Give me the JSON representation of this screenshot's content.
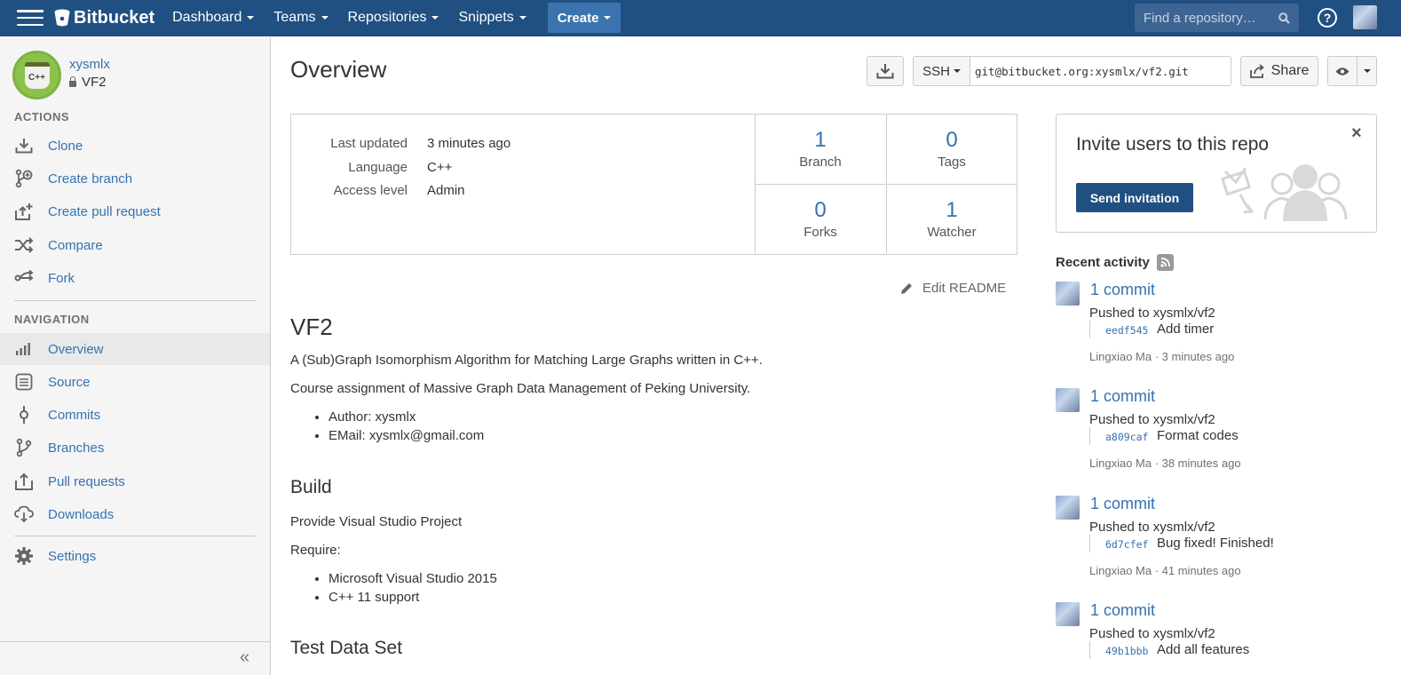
{
  "topbar": {
    "brand": "Bitbucket",
    "nav": [
      "Dashboard",
      "Teams",
      "Repositories",
      "Snippets"
    ],
    "create_label": "Create",
    "search_placeholder": "Find a repository…",
    "help": "?"
  },
  "sidebar": {
    "owner": "xysmlx",
    "repo": "VF2",
    "avatar_text": "C++",
    "actions_title": "ACTIONS",
    "actions": [
      {
        "label": "Clone",
        "icon": "download-icon"
      },
      {
        "label": "Create branch",
        "icon": "branch-plus-icon"
      },
      {
        "label": "Create pull request",
        "icon": "pull-request-plus-icon"
      },
      {
        "label": "Compare",
        "icon": "shuffle-icon"
      },
      {
        "label": "Fork",
        "icon": "fork-icon"
      }
    ],
    "navigation_title": "NAVIGATION",
    "navigation": [
      {
        "label": "Overview",
        "icon": "bar-chart-icon"
      },
      {
        "label": "Source",
        "icon": "document-icon"
      },
      {
        "label": "Commits",
        "icon": "commit-icon"
      },
      {
        "label": "Branches",
        "icon": "branch-icon"
      },
      {
        "label": "Pull requests",
        "icon": "pull-request-icon"
      },
      {
        "label": "Downloads",
        "icon": "cloud-download-icon"
      }
    ],
    "settings": {
      "label": "Settings",
      "icon": "gear-icon"
    },
    "collapse": "«"
  },
  "main": {
    "title": "Overview",
    "protocol": "SSH",
    "clone_url": "git@bitbucket.org:xysmlx/vf2.git",
    "share_label": "Share",
    "info": [
      {
        "key": "Last updated",
        "value": "3 minutes ago"
      },
      {
        "key": "Language",
        "value": "C++"
      },
      {
        "key": "Access level",
        "value": "Admin"
      }
    ],
    "stats": [
      {
        "num": "1",
        "label": "Branch"
      },
      {
        "num": "0",
        "label": "Tags"
      },
      {
        "num": "0",
        "label": "Forks"
      },
      {
        "num": "1",
        "label": "Watcher"
      }
    ],
    "edit_readme": "Edit README"
  },
  "readme": {
    "h1": "VF2",
    "p1": "A (Sub)Graph Isomorphism Algorithm for Matching Large Graphs written in C++.",
    "p2": "Course assignment of Massive Graph Data Management of Peking University.",
    "list1": [
      "Author: xysmlx",
      "EMail: xysmlx@gmail.com"
    ],
    "h2_build": "Build",
    "p3": "Provide Visual Studio Project",
    "p4": "Require:",
    "list2": [
      "Microsoft Visual Studio 2015",
      "C++ 11 support"
    ],
    "h2_test": "Test Data Set"
  },
  "invite": {
    "title": "Invite users to this repo",
    "button": "Send invitation",
    "close": "×"
  },
  "recent": {
    "title": "Recent activity",
    "items": [
      {
        "commits": "1 commit",
        "pushed": "Pushed to xysmlx/vf2",
        "hash": "eedf545",
        "message": "Add timer",
        "meta": "Lingxiao Ma · 3 minutes ago"
      },
      {
        "commits": "1 commit",
        "pushed": "Pushed to xysmlx/vf2",
        "hash": "a809caf",
        "message": "Format codes",
        "meta": "Lingxiao Ma · 38 minutes ago"
      },
      {
        "commits": "1 commit",
        "pushed": "Pushed to xysmlx/vf2",
        "hash": "6d7cfef",
        "message": "Bug fixed! Finished!",
        "meta": "Lingxiao Ma · 41 minutes ago"
      },
      {
        "commits": "1 commit",
        "pushed": "Pushed to xysmlx/vf2",
        "hash": "49b1bbb",
        "message": "Add all features",
        "meta": ""
      }
    ]
  }
}
